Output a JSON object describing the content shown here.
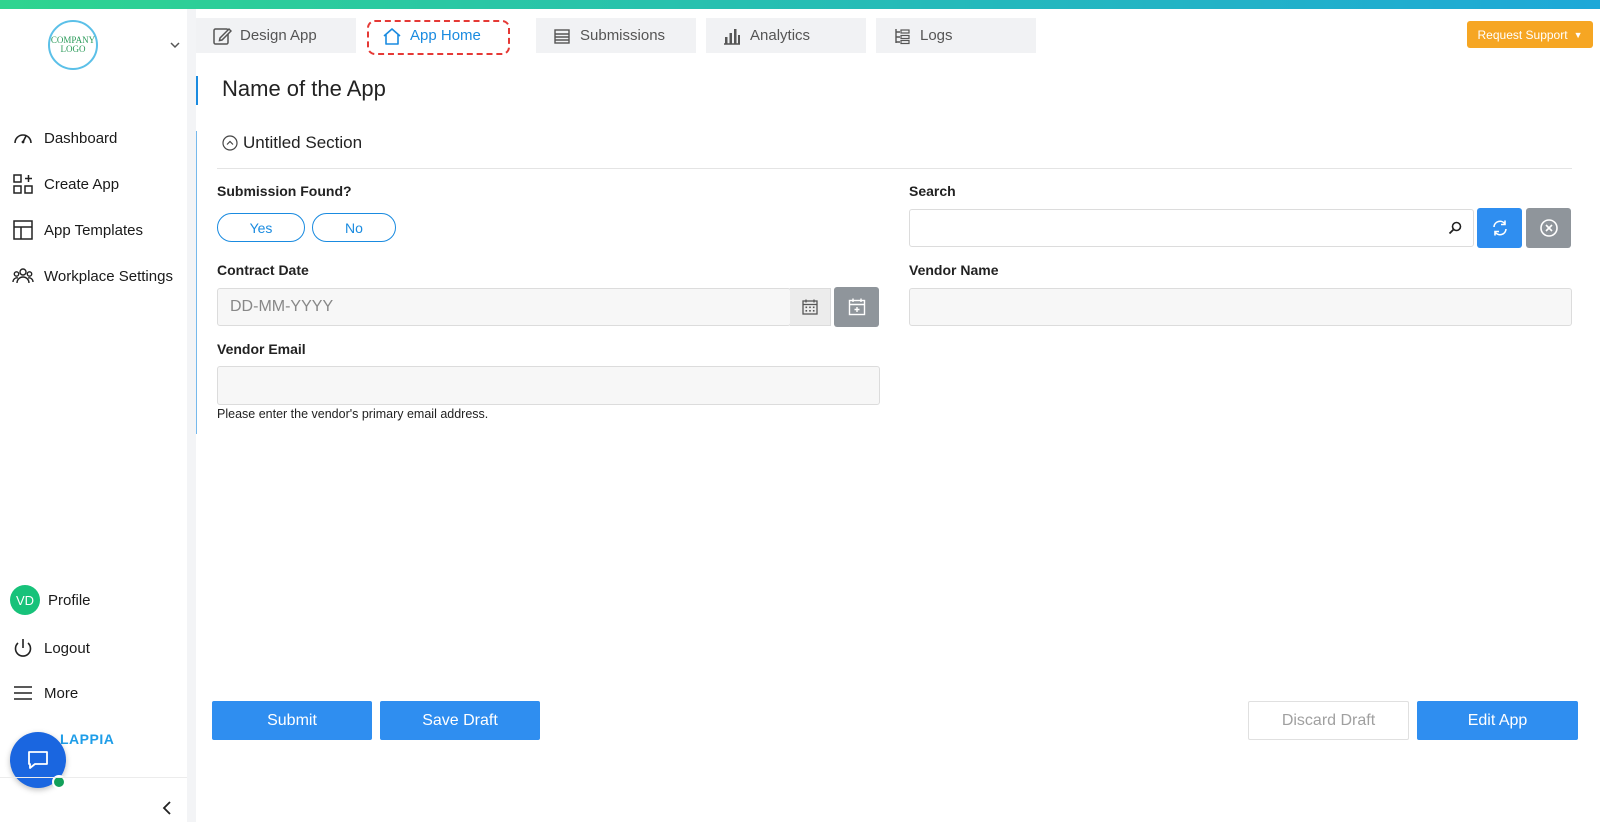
{
  "sidebar": {
    "logo_text": "COMPANY LOGO",
    "nav": [
      {
        "label": "Dashboard",
        "icon": "dashboard-gauge-icon"
      },
      {
        "label": "Create App",
        "icon": "create-app-grid-icon"
      },
      {
        "label": "App Templates",
        "icon": "templates-layout-icon"
      },
      {
        "label": "Workplace Settings",
        "icon": "users-group-icon"
      }
    ],
    "profile": {
      "initials": "VD",
      "label": "Profile"
    },
    "logout_label": "Logout",
    "more_label": "More",
    "brand_text": "LAPPIA"
  },
  "tabs": [
    {
      "label": "Design App",
      "icon": "edit-icon"
    },
    {
      "label": "App Home",
      "icon": "home-icon",
      "active": true
    },
    {
      "label": "Submissions",
      "icon": "list-icon"
    },
    {
      "label": "Analytics",
      "icon": "bar-chart-icon"
    },
    {
      "label": "Logs",
      "icon": "logs-icon"
    }
  ],
  "support_label": "Request Support",
  "page": {
    "title": "Name of the App",
    "section_title": "Untitled Section"
  },
  "form": {
    "submission_found_label": "Submission Found?",
    "yes_label": "Yes",
    "no_label": "No",
    "search_label": "Search",
    "search_value": "",
    "contract_date_label": "Contract Date",
    "contract_date_placeholder": "DD-MM-YYYY",
    "vendor_name_label": "Vendor Name",
    "vendor_name_value": "",
    "vendor_email_label": "Vendor Email",
    "vendor_email_value": "",
    "vendor_email_helper": "Please enter the vendor's primary email address."
  },
  "actions": {
    "submit_label": "Submit",
    "save_draft_label": "Save Draft",
    "discard_draft_label": "Discard Draft",
    "edit_app_label": "Edit App"
  },
  "colors": {
    "primary": "#2f8ef0",
    "accent_orange": "#f6a623",
    "avatar_green": "#17c27a",
    "chat_blue": "#1a66e0"
  }
}
